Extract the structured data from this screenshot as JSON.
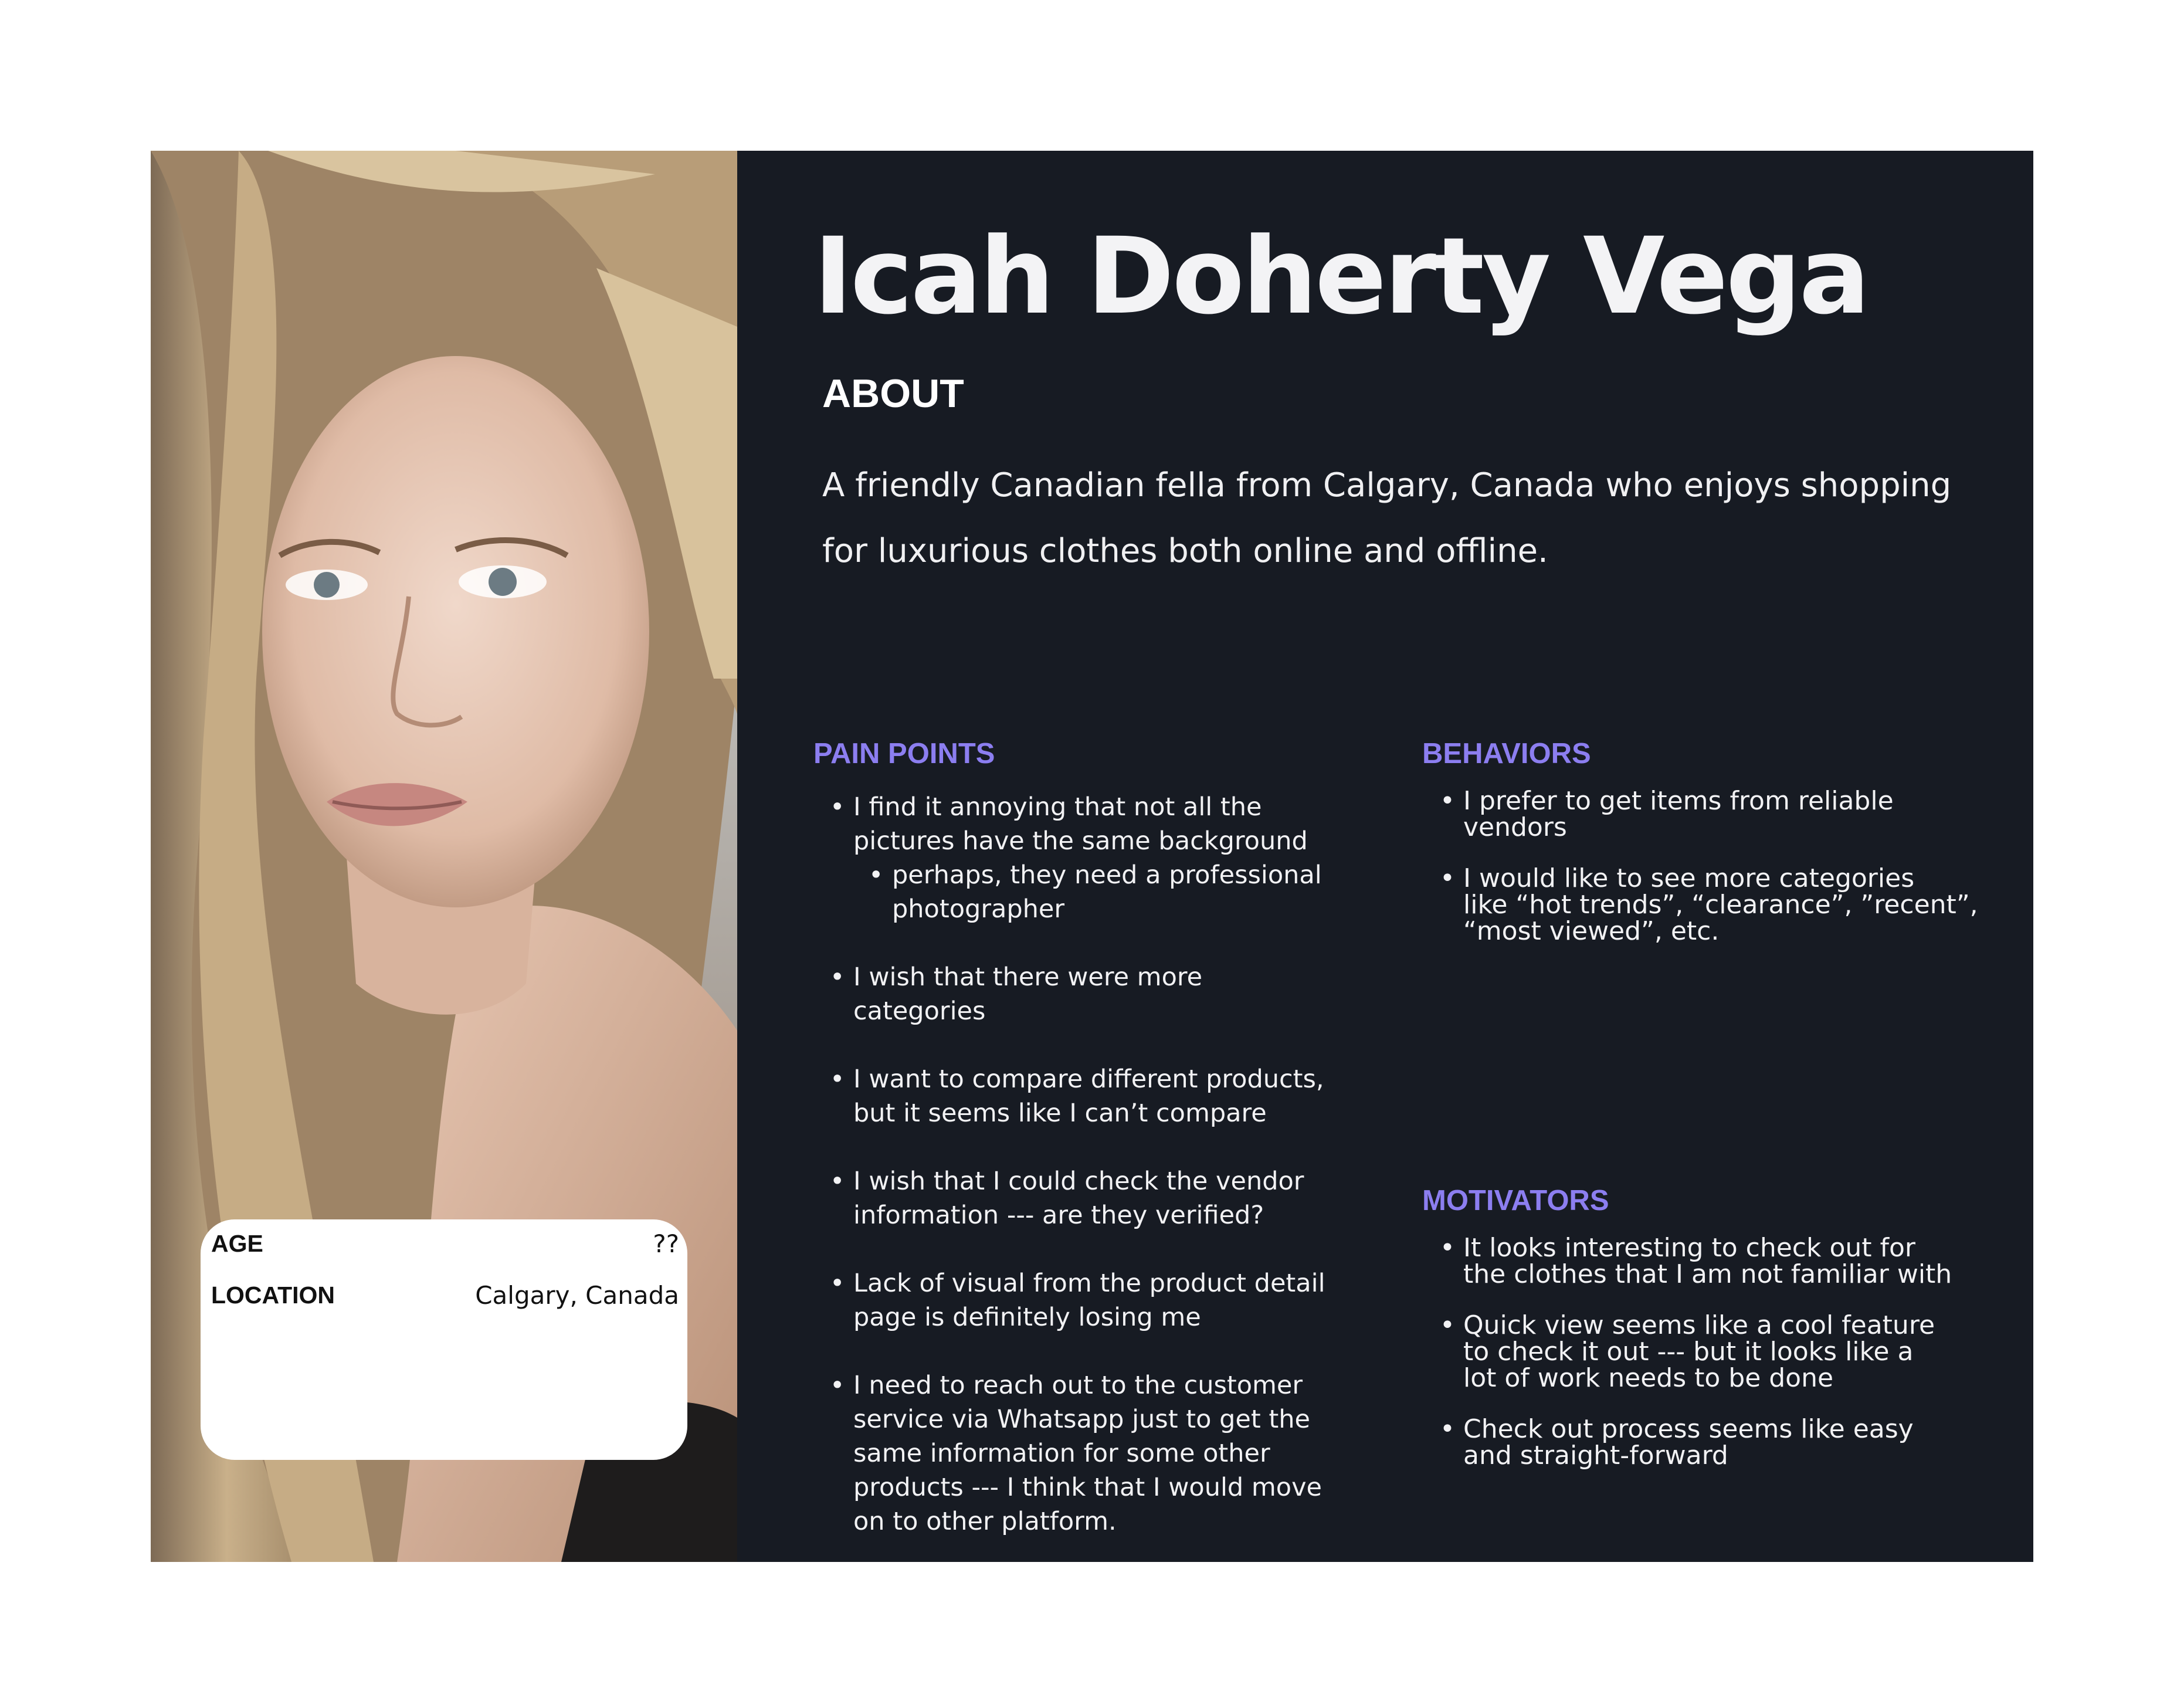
{
  "persona": {
    "name": "Icah Doherty Vega",
    "photo_alt": "portrait-photo"
  },
  "info": {
    "age_label": "AGE",
    "age_value": "??",
    "location_label": "LOCATION",
    "location_value": "Calgary, Canada"
  },
  "about": {
    "title": "ABOUT",
    "line1": "A friendly Canadian fella from Calgary, Canada who enjoys shopping",
    "line2": "for luxurious clothes both online and offline."
  },
  "pain_points": {
    "title": "PAIN POINTS",
    "items": [
      {
        "l1": "I find it annoying that not all the",
        "l2": "pictures have the same background"
      },
      {
        "l1": "perhaps, they need a professional",
        "l2": "photographer"
      },
      {
        "l1": "I wish that there were more",
        "l2": "categories"
      },
      {
        "l1": "I want to compare different products,",
        "l2": "but it seems like I can’t compare"
      },
      {
        "l1": "I wish that I could check the vendor",
        "l2": "information --- are they verified?"
      },
      {
        "l1": "Lack of visual from the product detail",
        "l2": "page is definitely losing me"
      },
      {
        "l1": "I need to reach out to the customer",
        "l2": "service via Whatsapp just to get the",
        "l3": "same information for some other",
        "l4": "products --- I think that I would move",
        "l5": "on to other platform."
      }
    ]
  },
  "behaviors": {
    "title": "BEHAVIORS",
    "items": [
      {
        "l1": "I prefer to get items from reliable",
        "l2": "vendors"
      },
      {
        "l1": "I would like to see more categories",
        "l2": "like “hot trends”, “clearance”, ”recent”,",
        "l3": "“most viewed”, etc."
      }
    ]
  },
  "motivators": {
    "title": "MOTIVATORS",
    "items": [
      {
        "l1": "It looks interesting to check out for",
        "l2": "the clothes that I am not familiar with"
      },
      {
        "l1": "Quick view seems like a cool feature",
        "l2": "to check it out --- but it looks like a",
        "l3": "lot of work needs to be done"
      },
      {
        "l1": "Check out process seems like easy",
        "l2": "and straight-forward"
      }
    ]
  },
  "colors": {
    "panel": "#171b23",
    "accent": "#8c7ef0",
    "text": "#f2f2f4"
  }
}
